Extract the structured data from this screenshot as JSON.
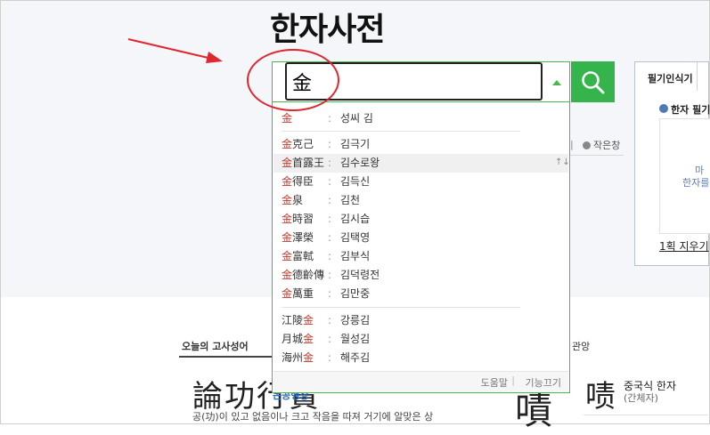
{
  "page": {
    "title": "한자사전"
  },
  "search": {
    "value": "金"
  },
  "suggestions": {
    "group1": [
      {
        "hanja_hl": "金",
        "hanja_rest": "",
        "reading": "성씨 김"
      }
    ],
    "group2": [
      {
        "hanja_hl": "金",
        "hanja_rest": "克己",
        "reading": "김극기"
      },
      {
        "hanja_hl": "金",
        "hanja_rest": "首露王",
        "reading": "김수로왕"
      },
      {
        "hanja_hl": "金",
        "hanja_rest": "得臣",
        "reading": "김득신"
      },
      {
        "hanja_hl": "金",
        "hanja_rest": "泉",
        "reading": "김천"
      },
      {
        "hanja_hl": "金",
        "hanja_rest": "時習",
        "reading": "김시습"
      },
      {
        "hanja_hl": "金",
        "hanja_rest": "澤榮",
        "reading": "김택영"
      },
      {
        "hanja_hl": "金",
        "hanja_rest": "富軾",
        "reading": "김부식"
      },
      {
        "hanja_hl": "金",
        "hanja_rest": "德齡傳",
        "reading": "김덕령전"
      },
      {
        "hanja_hl": "金",
        "hanja_rest": "萬重",
        "reading": "김만중"
      }
    ],
    "group3": [
      {
        "hanja_pre": "江陵",
        "hanja_hl": "金",
        "reading": "강릉김"
      },
      {
        "hanja_pre": "月城",
        "hanja_hl": "金",
        "reading": "월성김"
      },
      {
        "hanja_pre": "海州",
        "hanja_hl": "金",
        "reading": "해주김"
      }
    ],
    "separator": ":",
    "arrows": "↑↓",
    "footer": {
      "help": "도움말",
      "pipe": "|",
      "turn_off": "기능끄기"
    }
  },
  "side_panel": {
    "tab": "필기인식기",
    "sub": "한자 필기",
    "canvas_hint_1": "마",
    "canvas_hint_2": "한자를",
    "clear": "1획 지우기"
  },
  "small_window": "작은창",
  "tick": "|",
  "below": {
    "section_label": "오늘의 고사성어",
    "section_label2": "관앙",
    "idiom": "論功行賞",
    "idiom_reading": "논공행상",
    "idiom_meaning": "공(功)이 있고 없음이나 크고 작음을 따져 거기에 알맞은 상",
    "big_char": "嘖",
    "card_char": "啧",
    "card_title": "중국식 한자",
    "card_sub": "(간체자)"
  },
  "colors": {
    "accent_green": "#34b44a",
    "highlight_red": "#c0392b",
    "annotation_red": "#e0262e"
  },
  "icons": {
    "search": "search-icon",
    "dropdown": "triangle-up-icon"
  }
}
